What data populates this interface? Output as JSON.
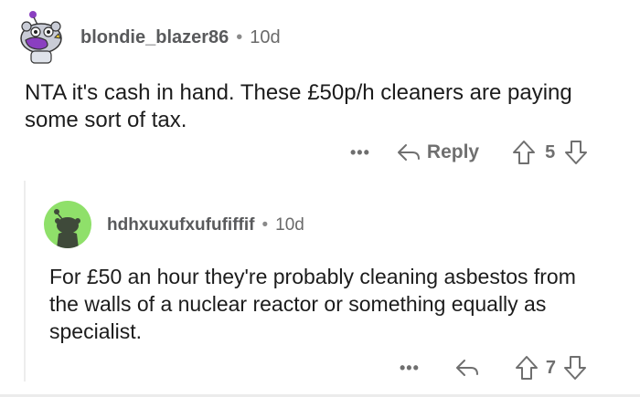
{
  "comments": [
    {
      "username": "blondie_blazer86",
      "age": "10d",
      "body": "NTA it's cash in hand. These £50p/h cleaners are paying some sort of tax.",
      "more": "•••",
      "reply_label": "Reply",
      "score": "5"
    },
    {
      "username": "hdhxuxufxufufiffif",
      "age": "10d",
      "body": "For £50 an hour they're probably cleaning asbestos from the walls of a nuclear reactor or something equally as specialist.",
      "more": "•••",
      "score": "7"
    }
  ],
  "separator": "•",
  "colors": {
    "avatar_green": "#8fe06a",
    "avatar_purple": "#8a3fc0",
    "text": "#1c1c1c",
    "muted": "#6f6f6f"
  }
}
